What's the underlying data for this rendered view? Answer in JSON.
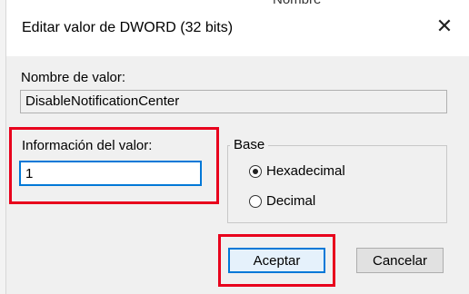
{
  "background": {
    "partial_text": "Nombre"
  },
  "dialog": {
    "title": "Editar valor de DWORD (32 bits)",
    "close_glyph": "✕",
    "value_name_label": "Nombre de valor:",
    "value_name": "DisableNotificationCenter",
    "value_data_label": "Información del valor:",
    "value_data": "1",
    "base": {
      "legend": "Base",
      "options": [
        "Hexadecimal",
        "Decimal"
      ],
      "selected": "Hexadecimal"
    },
    "buttons": {
      "ok": "Aceptar",
      "cancel": "Cancelar"
    }
  },
  "colors": {
    "highlight": "#e8001c",
    "focus": "#0078d7"
  }
}
